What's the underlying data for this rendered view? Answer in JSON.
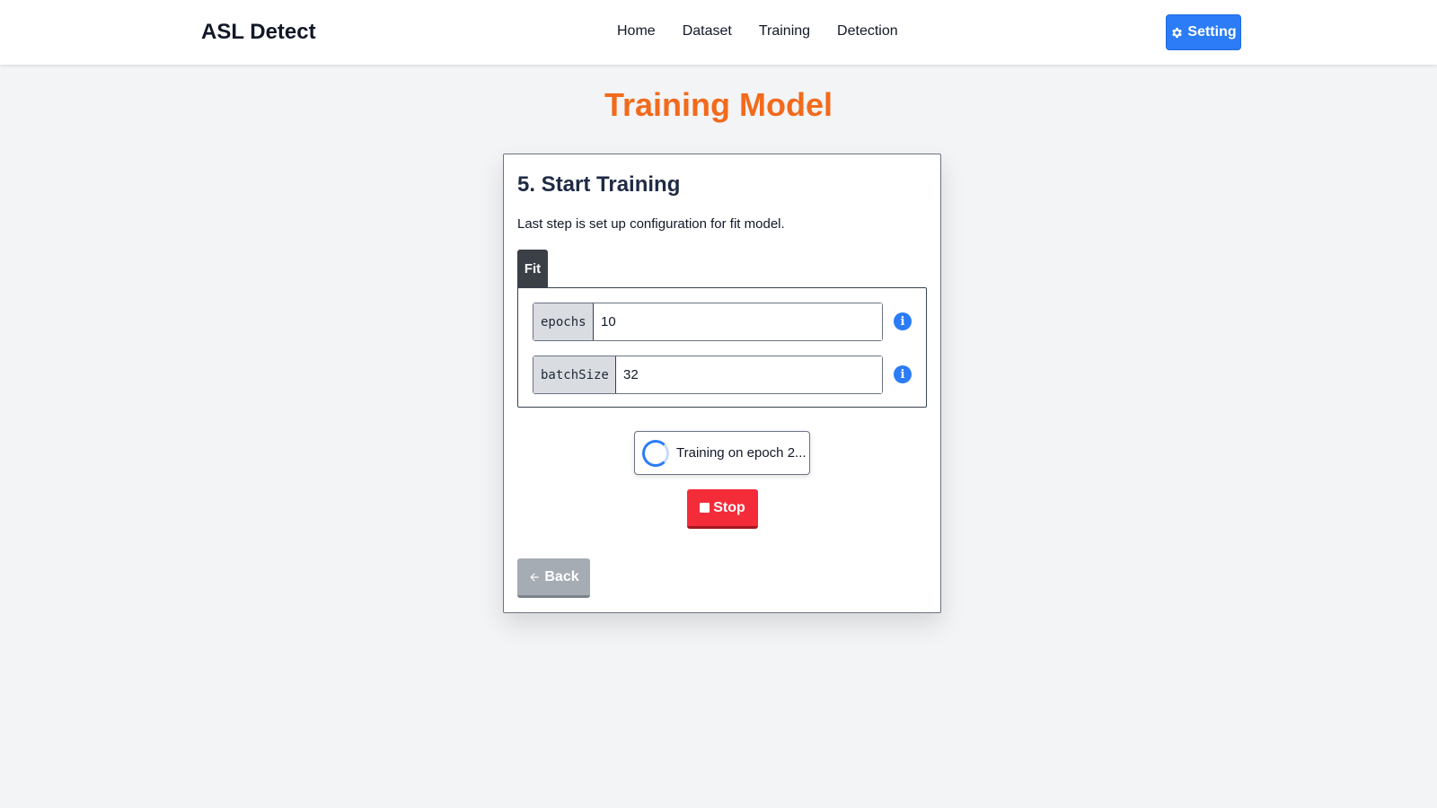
{
  "navbar": {
    "brand": "ASL Detect",
    "links": [
      "Home",
      "Dataset",
      "Training",
      "Detection"
    ],
    "setting_label": "Setting"
  },
  "page": {
    "title": "Training Model"
  },
  "card": {
    "step_title": "5. Start Training",
    "description": "Last step is set up configuration for fit model.",
    "tab_label": "Fit",
    "fields": [
      {
        "label": "epochs",
        "value": "10"
      },
      {
        "label": "batchSize",
        "value": "32"
      }
    ],
    "info_glyph": "i",
    "status_text": "Training on epoch 2...",
    "stop_label": "Stop",
    "back_label": "Back"
  },
  "colors": {
    "accent": "#2b7cf6",
    "title": "#f26a1b",
    "danger": "#f42c3a",
    "secondary": "#a6acb4"
  },
  "icons": {
    "setting": "gear-icon",
    "info": "info-icon",
    "status": "spinner-icon",
    "stop": "stop-icon",
    "back": "arrow-left-icon"
  }
}
